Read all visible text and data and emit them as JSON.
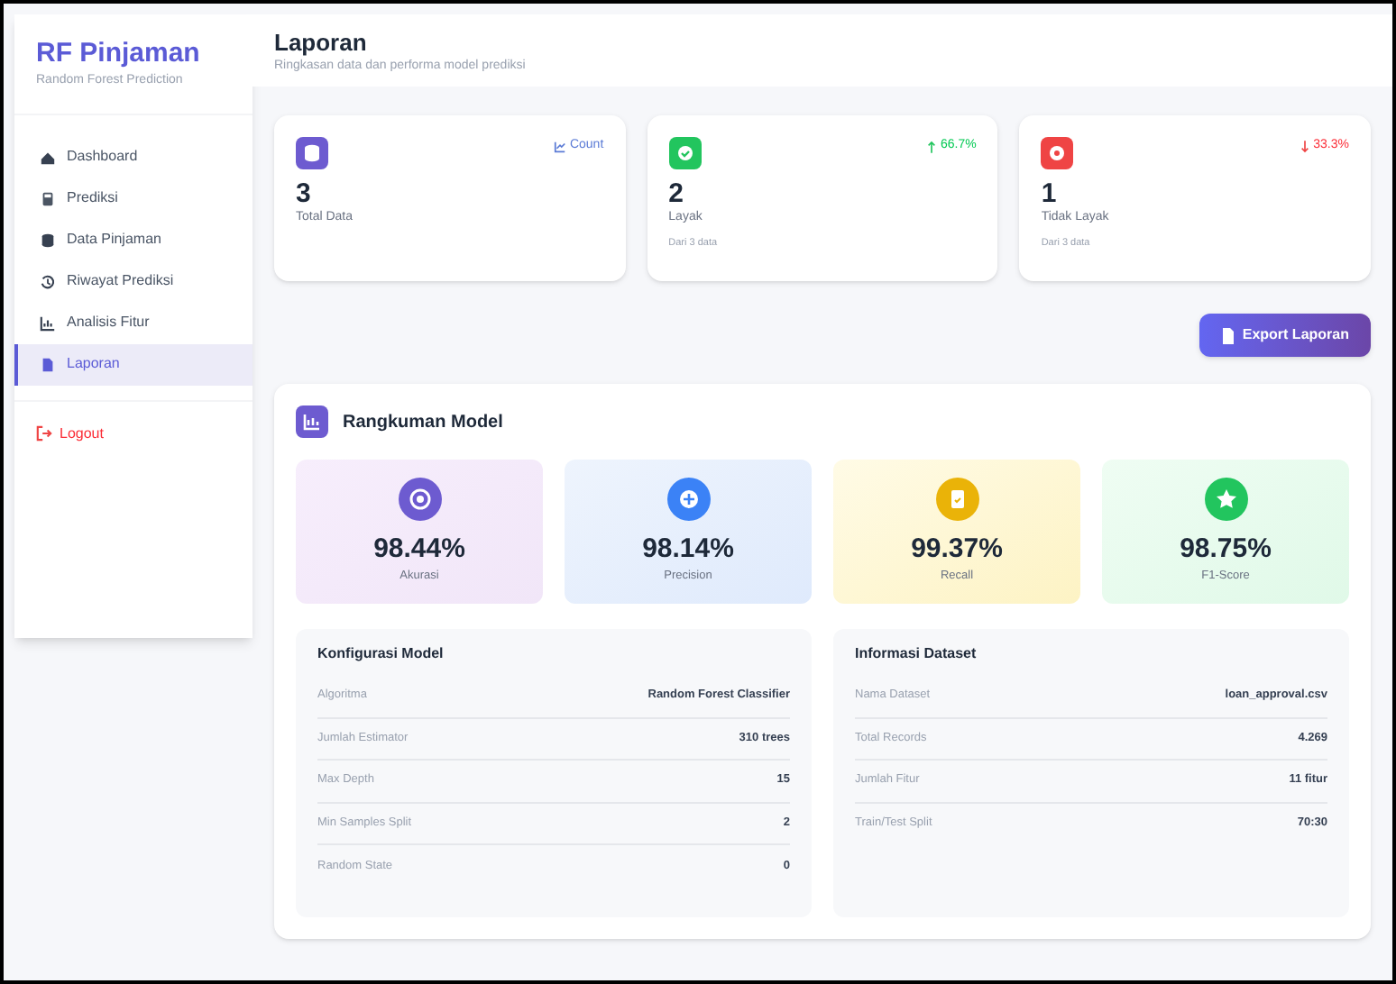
{
  "brand": {
    "title": "RF Pinjaman",
    "subtitle": "Random Forest Prediction"
  },
  "sidebar": {
    "items": [
      {
        "label": "Dashboard",
        "selected": false
      },
      {
        "label": "Prediksi",
        "selected": false
      },
      {
        "label": "Data Pinjaman",
        "selected": false
      },
      {
        "label": "Riwayat Prediksi",
        "selected": false
      },
      {
        "label": "Analisis Fitur",
        "selected": false
      },
      {
        "label": "Laporan",
        "selected": true
      }
    ],
    "logout": "Logout"
  },
  "header": {
    "title": "Laporan",
    "subtitle": "Ringkasan data dan performa model prediksi"
  },
  "stats": [
    {
      "value": "3",
      "label": "Total Data",
      "badge": "Count",
      "kind": "neutral",
      "color": "#6d5bd0"
    },
    {
      "value": "2",
      "label": "Layak",
      "note": "Dari 3 data",
      "badge": "66.7%",
      "kind": "up",
      "color": "#22c55e"
    },
    {
      "value": "1",
      "label": "Tidak Layak",
      "note": "Dari 3 data",
      "badge": "33.3%",
      "kind": "down",
      "color": "#ef4444"
    }
  ],
  "export_button": "Export Laporan",
  "summary": {
    "title": "Rangkuman Model",
    "metrics": [
      {
        "value": "98.44%",
        "label": "Akurasi",
        "color": "#6d5bd0"
      },
      {
        "value": "98.14%",
        "label": "Precision",
        "color": "#3b82f6"
      },
      {
        "value": "99.37%",
        "label": "Recall",
        "color": "#eab308"
      },
      {
        "value": "98.75%",
        "label": "F1-Score",
        "color": "#22c55e"
      }
    ],
    "config": {
      "title": "Konfigurasi Model",
      "rows": [
        {
          "key": "Algoritma",
          "value": "Random Forest Classifier"
        },
        {
          "key": "Jumlah Estimator",
          "value": "310 trees"
        },
        {
          "key": "Max Depth",
          "value": "15"
        },
        {
          "key": "Min Samples Split",
          "value": "2"
        },
        {
          "key": "Random State",
          "value": "0"
        }
      ]
    },
    "dataset": {
      "title": "Informasi Dataset",
      "rows": [
        {
          "key": "Nama Dataset",
          "value": "loan_approval.csv"
        },
        {
          "key": "Total Records",
          "value": "4.269"
        },
        {
          "key": "Jumlah Fitur",
          "value": "11 fitur"
        },
        {
          "key": "Train/Test Split",
          "value": "70:30"
        }
      ]
    }
  }
}
